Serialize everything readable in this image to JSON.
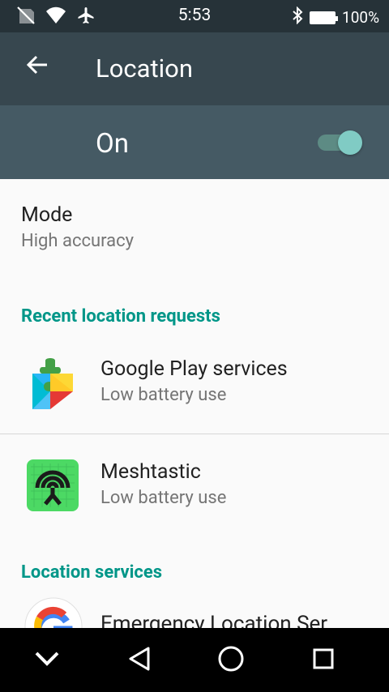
{
  "status_bar": {
    "time": "5:53",
    "battery_percent": "100%",
    "icons": [
      "no-sim-icon",
      "wifi-icon",
      "airplane-icon",
      "bluetooth-icon",
      "battery-icon"
    ]
  },
  "app_bar": {
    "back_icon": "arrow-left-icon",
    "title": "Location"
  },
  "location_switch": {
    "label": "On",
    "checked": true
  },
  "mode": {
    "title": "Mode",
    "summary": "High accuracy"
  },
  "recent_requests": {
    "header": "Recent location requests",
    "items": [
      {
        "name": "Google Play services",
        "summary": "Low battery use",
        "icon": "google-play-services-icon"
      },
      {
        "name": "Meshtastic",
        "summary": "Low battery use",
        "icon": "meshtastic-icon"
      }
    ]
  },
  "location_services": {
    "header": "Location services",
    "items": [
      {
        "name": "Emergency Location Ser",
        "icon": "google-g-icon"
      }
    ]
  },
  "nav_bar": {
    "buttons": [
      "chevron-down-icon",
      "back-triangle-icon",
      "home-circle-icon",
      "recents-square-icon"
    ]
  },
  "colors": {
    "status_bar": "#263238",
    "app_bar": "#37474f",
    "switch_bar": "#455a64",
    "accent": "#009688",
    "toggle_thumb": "#80cbc4"
  }
}
